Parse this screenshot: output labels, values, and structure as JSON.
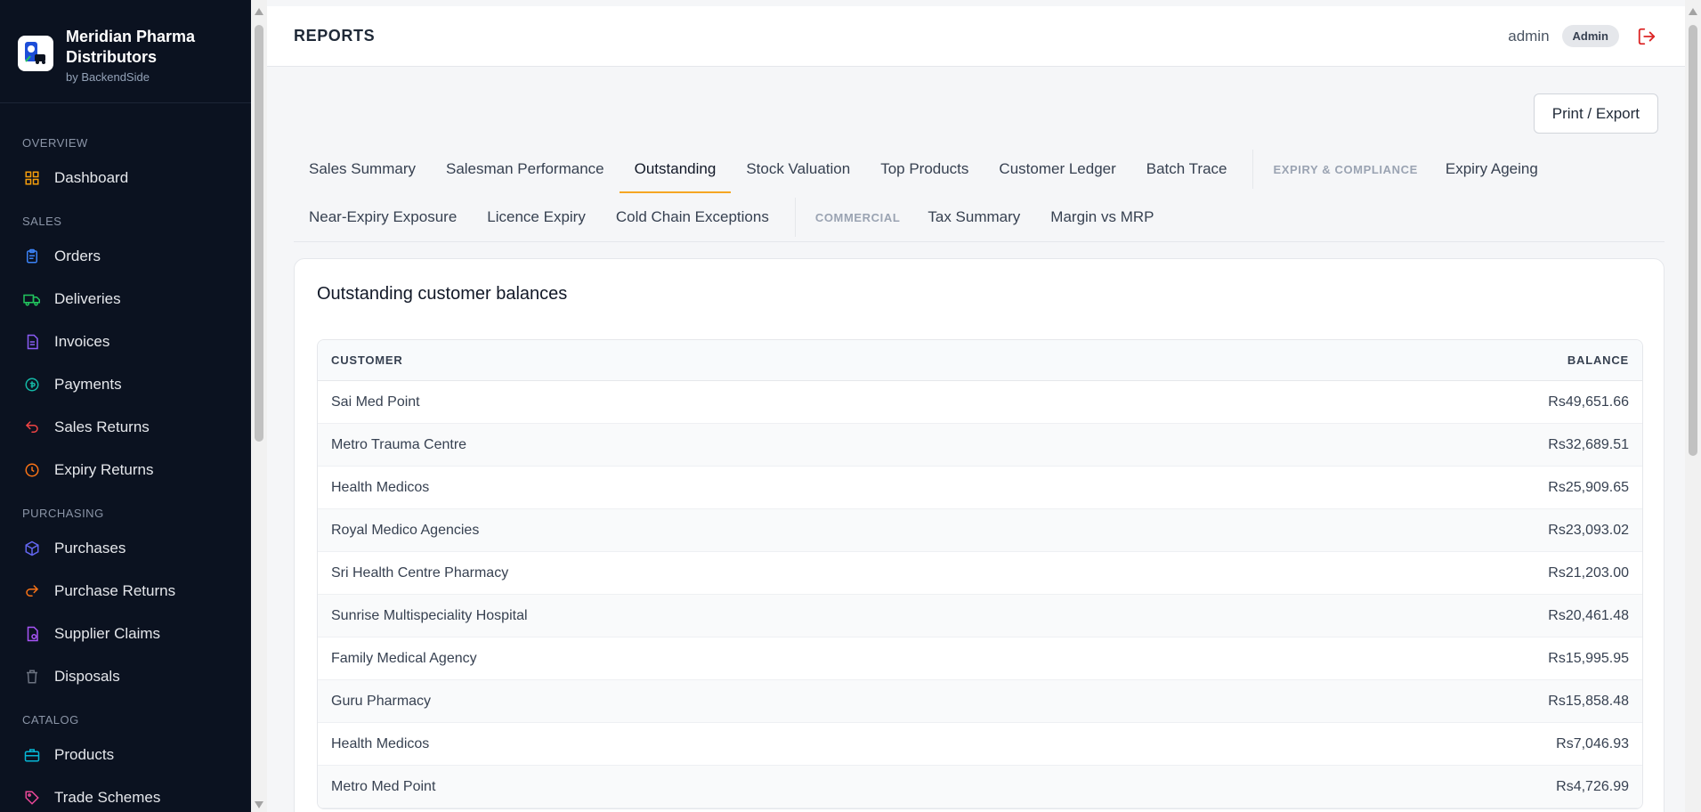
{
  "brand": {
    "name": "Meridian Pharma Distributors",
    "sub": "by BackendSide"
  },
  "sidebar": {
    "sections": [
      {
        "label": "OVERVIEW",
        "items": [
          {
            "label": "Dashboard",
            "icon": "grid-icon",
            "color": "#f59e0b"
          }
        ]
      },
      {
        "label": "SALES",
        "items": [
          {
            "label": "Orders",
            "icon": "clipboard-icon",
            "color": "#3b82f6"
          },
          {
            "label": "Deliveries",
            "icon": "truck-icon",
            "color": "#22c55e"
          },
          {
            "label": "Invoices",
            "icon": "document-icon",
            "color": "#8b5cf6"
          },
          {
            "label": "Payments",
            "icon": "coin-icon",
            "color": "#14b8a6"
          },
          {
            "label": "Sales Returns",
            "icon": "return-icon",
            "color": "#ef4444"
          },
          {
            "label": "Expiry Returns",
            "icon": "clock-icon",
            "color": "#f97316"
          }
        ]
      },
      {
        "label": "PURCHASING",
        "items": [
          {
            "label": "Purchases",
            "icon": "cube-icon",
            "color": "#6366f1"
          },
          {
            "label": "Purchase Returns",
            "icon": "forward-icon",
            "color": "#f97316"
          },
          {
            "label": "Supplier Claims",
            "icon": "claim-icon",
            "color": "#a855f7"
          },
          {
            "label": "Disposals",
            "icon": "trash-icon",
            "color": "#6b7280"
          }
        ]
      },
      {
        "label": "CATALOG",
        "items": [
          {
            "label": "Products",
            "icon": "briefcase-icon",
            "color": "#06b6d4"
          },
          {
            "label": "Trade Schemes",
            "icon": "tag-icon",
            "color": "#ec4899"
          }
        ]
      }
    ]
  },
  "topbar": {
    "title": "REPORTS",
    "user": "admin",
    "role": "Admin",
    "accent": "#dc2626"
  },
  "actions": {
    "export_label": "Print / Export"
  },
  "tabs": {
    "row1": [
      {
        "label": "Sales Summary"
      },
      {
        "label": "Salesman Performance"
      },
      {
        "label": "Outstanding",
        "active": true
      },
      {
        "label": "Stock Valuation"
      },
      {
        "label": "Top Products"
      },
      {
        "label": "Customer Ledger"
      },
      {
        "label": "Batch Trace"
      }
    ],
    "group_expiry": "EXPIRY & COMPLIANCE",
    "row1_after": [
      {
        "label": "Expiry Ageing"
      }
    ],
    "row2": [
      {
        "label": "Near-Expiry Exposure"
      },
      {
        "label": "Licence Expiry"
      },
      {
        "label": "Cold Chain Exceptions"
      }
    ],
    "group_commercial": "COMMERCIAL",
    "row2_after": [
      {
        "label": "Tax Summary"
      },
      {
        "label": "Margin vs MRP"
      }
    ],
    "active_color": "#f5a623"
  },
  "report": {
    "title": "Outstanding customer balances",
    "columns": {
      "customer": "CUSTOMER",
      "balance": "BALANCE"
    },
    "rows": [
      {
        "customer": "Sai Med Point",
        "balance": "Rs49,651.66"
      },
      {
        "customer": "Metro Trauma Centre",
        "balance": "Rs32,689.51"
      },
      {
        "customer": "Health Medicos",
        "balance": "Rs25,909.65"
      },
      {
        "customer": "Royal Medico Agencies",
        "balance": "Rs23,093.02"
      },
      {
        "customer": "Sri Health Centre Pharmacy",
        "balance": "Rs21,203.00"
      },
      {
        "customer": "Sunrise Multispeciality Hospital",
        "balance": "Rs20,461.48"
      },
      {
        "customer": "Family Medical Agency",
        "balance": "Rs15,995.95"
      },
      {
        "customer": "Guru Pharmacy",
        "balance": "Rs15,858.48"
      },
      {
        "customer": "Health Medicos",
        "balance": "Rs7,046.93"
      },
      {
        "customer": "Metro Med Point",
        "balance": "Rs4,726.99"
      }
    ]
  }
}
